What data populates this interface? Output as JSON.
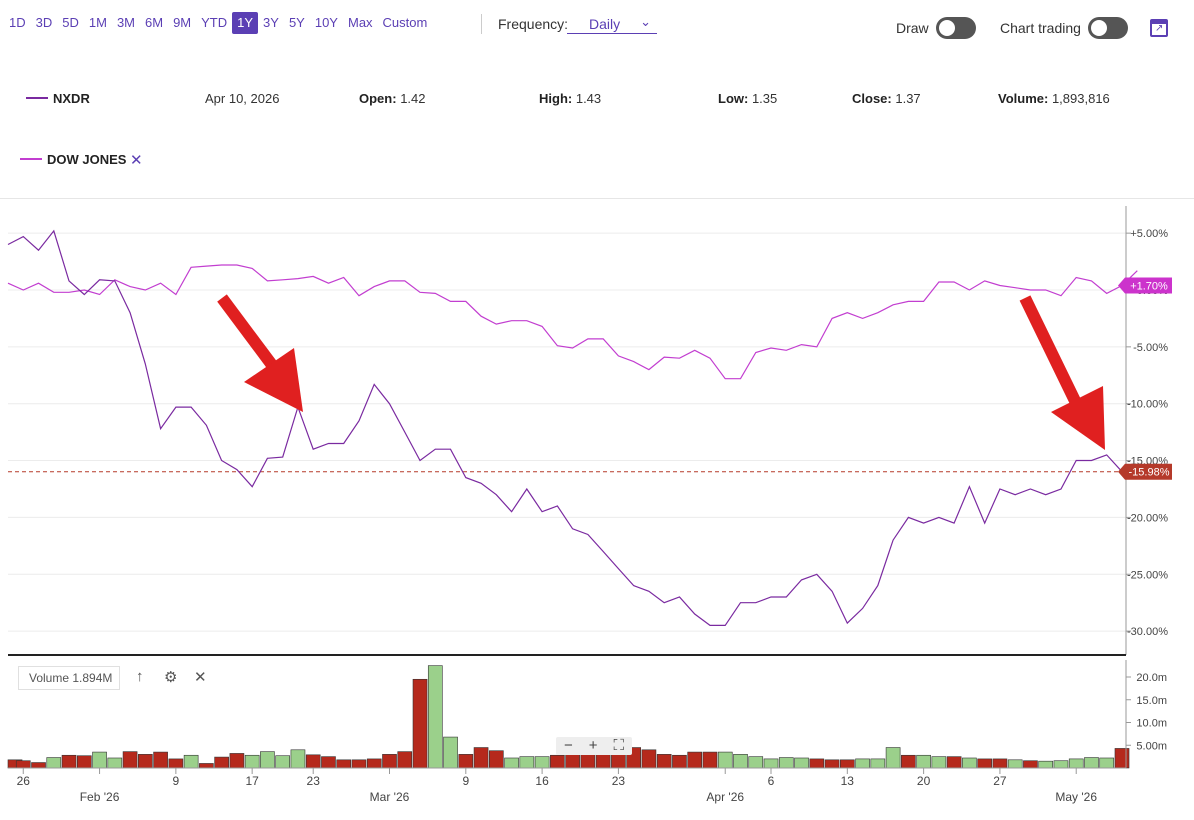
{
  "toolbar": {
    "ranges": [
      "1D",
      "3D",
      "5D",
      "1M",
      "3M",
      "6M",
      "9M",
      "YTD",
      "1Y",
      "3Y",
      "5Y",
      "10Y",
      "Max",
      "Custom"
    ],
    "active_range": "1Y",
    "frequency_label": "Frequency:",
    "frequency_value": "Daily",
    "draw_label": "Draw",
    "chart_trading_label": "Chart trading"
  },
  "quote": {
    "symbol": "NXDR",
    "date": "Apr 10, 2026",
    "open_label": "Open:",
    "open": "1.42",
    "high_label": "High:",
    "high": "1.43",
    "low_label": "Low:",
    "low": "1.35",
    "close_label": "Close:",
    "close": "1.37",
    "volume_label": "Volume:",
    "volume": "1,893,816"
  },
  "comparison": {
    "label": "DOW JONES"
  },
  "volume_panel": {
    "label": "Volume 1.894M"
  },
  "colors": {
    "accent": "#5b3fb4",
    "nxdr": "#7a2aa0",
    "dow": "#c23ed0",
    "up_bar": "#9bd08b",
    "down_bar": "#b5291c",
    "last_tag": "#b53a2a",
    "dow_tag": "#cc33cc",
    "arrow": "#e02020"
  },
  "chart_data": [
    {
      "type": "line",
      "title": "",
      "y_unit": "percent change",
      "ylim": [
        -32,
        7
      ],
      "y_ticks": [
        "+5.00%",
        "0.00%",
        "-5.00%",
        "-10.00%",
        "-15.00%",
        "-20.00%",
        "-25.00%",
        "-30.00%"
      ],
      "y_tick_values": [
        5,
        0,
        -5,
        -10,
        -15,
        -20,
        -25,
        -30
      ],
      "x_tick_labels": [
        "26",
        "Feb '26",
        "9",
        "17",
        "23",
        "Mar '26",
        "9",
        "16",
        "23",
        "Apr '26",
        "6",
        "13",
        "20",
        "27",
        "May '26"
      ],
      "x_tick_index": [
        1,
        6,
        11,
        16,
        20,
        25,
        30,
        35,
        40,
        47,
        50,
        55,
        60,
        65,
        70
      ],
      "series": [
        {
          "name": "NXDR",
          "values": [
            4.0,
            4.7,
            3.5,
            5.2,
            0.8,
            -0.4,
            0.9,
            0.8,
            -2.0,
            -6.5,
            -12.2,
            -10.3,
            -10.3,
            -11.9,
            -15.0,
            -15.8,
            -17.3,
            -14.8,
            -14.7,
            -10.3,
            -14.0,
            -13.5,
            -13.5,
            -11.5,
            -8.3,
            -10.0,
            -12.5,
            -15.0,
            -14.0,
            -14.0,
            -16.5,
            -17.0,
            -18.0,
            -19.5,
            -17.5,
            -19.5,
            -19.0,
            -21.0,
            -21.5,
            -23.0,
            -24.5,
            -26.0,
            -26.5,
            -27.5,
            -27.0,
            -28.5,
            -29.5,
            -29.5,
            -27.5,
            -27.5,
            -27.0,
            -27.0,
            -25.5,
            -25.0,
            -26.5,
            -29.3,
            -28.0,
            -26.0,
            -22.0,
            -20.0,
            -20.5,
            -20.0,
            -20.5,
            -17.3,
            -20.5,
            -17.5,
            -18.0,
            -17.5,
            -18.0,
            -17.5,
            -15.0,
            -15.0,
            -14.5,
            -15.98
          ]
        },
        {
          "name": "DOW JONES",
          "values": [
            0.6,
            0.0,
            0.6,
            -0.2,
            -0.2,
            0.0,
            -0.4,
            0.9,
            0.3,
            0.0,
            0.6,
            -0.4,
            2.0,
            2.1,
            2.2,
            2.2,
            1.9,
            0.8,
            0.9,
            1.0,
            1.2,
            0.6,
            1.1,
            -0.5,
            0.3,
            0.8,
            0.8,
            -0.2,
            -0.3,
            -1.0,
            -1.0,
            -2.3,
            -3.0,
            -2.7,
            -2.7,
            -3.2,
            -4.9,
            -5.1,
            -4.3,
            -4.3,
            -5.8,
            -6.3,
            -7.0,
            -5.9,
            -6.0,
            -5.3,
            -6.0,
            -7.8,
            -7.8,
            -5.5,
            -5.1,
            -5.3,
            -4.8,
            -5.0,
            -2.5,
            -2.0,
            -2.5,
            -2.0,
            -1.3,
            -1.0,
            -1.0,
            0.7,
            0.7,
            0.0,
            0.8,
            0.4,
            0.2,
            0.0,
            0.0,
            -0.5,
            1.1,
            0.8,
            -0.3,
            0.4,
            1.7
          ]
        }
      ],
      "last_value_tags": [
        "+1.70%",
        "-15.98%"
      ],
      "reference_line": -15.98
    },
    {
      "type": "bar",
      "title": "Volume",
      "y_ticks": [
        "20.0m",
        "15.0m",
        "10.0m",
        "5.00m"
      ],
      "y_tick_values": [
        20,
        15,
        10,
        5
      ],
      "values_millions": [
        1.8,
        1.6,
        1.2,
        2.3,
        2.8,
        2.7,
        3.5,
        2.2,
        3.6,
        3.0,
        3.5,
        2.0,
        2.8,
        1.0,
        2.4,
        3.2,
        2.8,
        3.6,
        2.7,
        4.0,
        2.9,
        2.5,
        1.8,
        1.8,
        2.0,
        3.0,
        3.6,
        19.5,
        22.5,
        6.8,
        3.0,
        4.5,
        3.8,
        2.2,
        2.5,
        2.5,
        2.8,
        3.5,
        3.0,
        3.0,
        3.2,
        4.5,
        4.0,
        3.0,
        2.8,
        3.5,
        3.5,
        3.5,
        3.0,
        2.5,
        2.0,
        2.3,
        2.2,
        2.0,
        1.8,
        1.8,
        2.0,
        2.0,
        4.5,
        2.8,
        2.8,
        2.5,
        2.5,
        2.2,
        2.0,
        2.0,
        1.8,
        1.6,
        1.5,
        1.6,
        2.0,
        2.3,
        2.2,
        4.3
      ],
      "down": [
        1,
        1,
        1,
        0,
        1,
        1,
        0,
        0,
        1,
        1,
        1,
        1,
        0,
        1,
        1,
        1,
        0,
        0,
        0,
        0,
        1,
        1,
        1,
        1,
        1,
        1,
        1,
        1,
        0,
        0,
        1,
        1,
        1,
        0,
        0,
        0,
        1,
        1,
        1,
        1,
        1,
        1,
        1,
        1,
        1,
        1,
        1,
        0,
        0,
        0,
        0,
        0,
        0,
        1,
        1,
        1,
        0,
        0,
        0,
        1,
        0,
        0,
        1,
        0,
        1,
        1,
        0,
        1,
        0,
        0,
        0,
        0,
        0,
        1
      ]
    }
  ]
}
